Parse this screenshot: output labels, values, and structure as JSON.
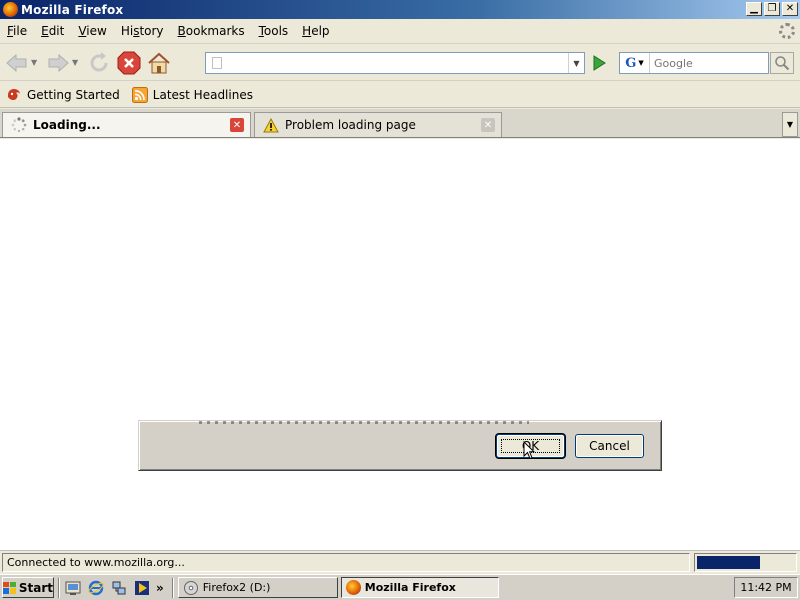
{
  "window": {
    "title": "Mozilla Firefox"
  },
  "menubar": {
    "items": [
      "File",
      "Edit",
      "View",
      "History",
      "Bookmarks",
      "Tools",
      "Help"
    ],
    "accelerators": [
      "F",
      "E",
      "V",
      "s",
      "B",
      "T",
      "H"
    ]
  },
  "navbar": {
    "url_value": "",
    "search_placeholder": "Google",
    "search_engine": "G"
  },
  "bookmarks": {
    "items": [
      "Getting Started",
      "Latest Headlines"
    ]
  },
  "tabs": [
    {
      "label": "Loading...",
      "active": true
    },
    {
      "label": "Problem loading page",
      "active": false
    }
  ],
  "dialog": {
    "ok_label": "OK",
    "cancel_label": "Cancel"
  },
  "statusbar": {
    "text": "Connected to www.mozilla.org...",
    "progress_fraction": 0.65
  },
  "taskbar": {
    "start_label": "Start",
    "more_glyph": "»",
    "tasks": [
      "Firefox2 (D:)",
      "Mozilla Firefox"
    ],
    "clock": "11:42 PM"
  },
  "colors": {
    "title_start": "#0a246a",
    "progress": "#0a246a",
    "stop_red": "#d9453a",
    "go_green": "#3aa63a"
  }
}
